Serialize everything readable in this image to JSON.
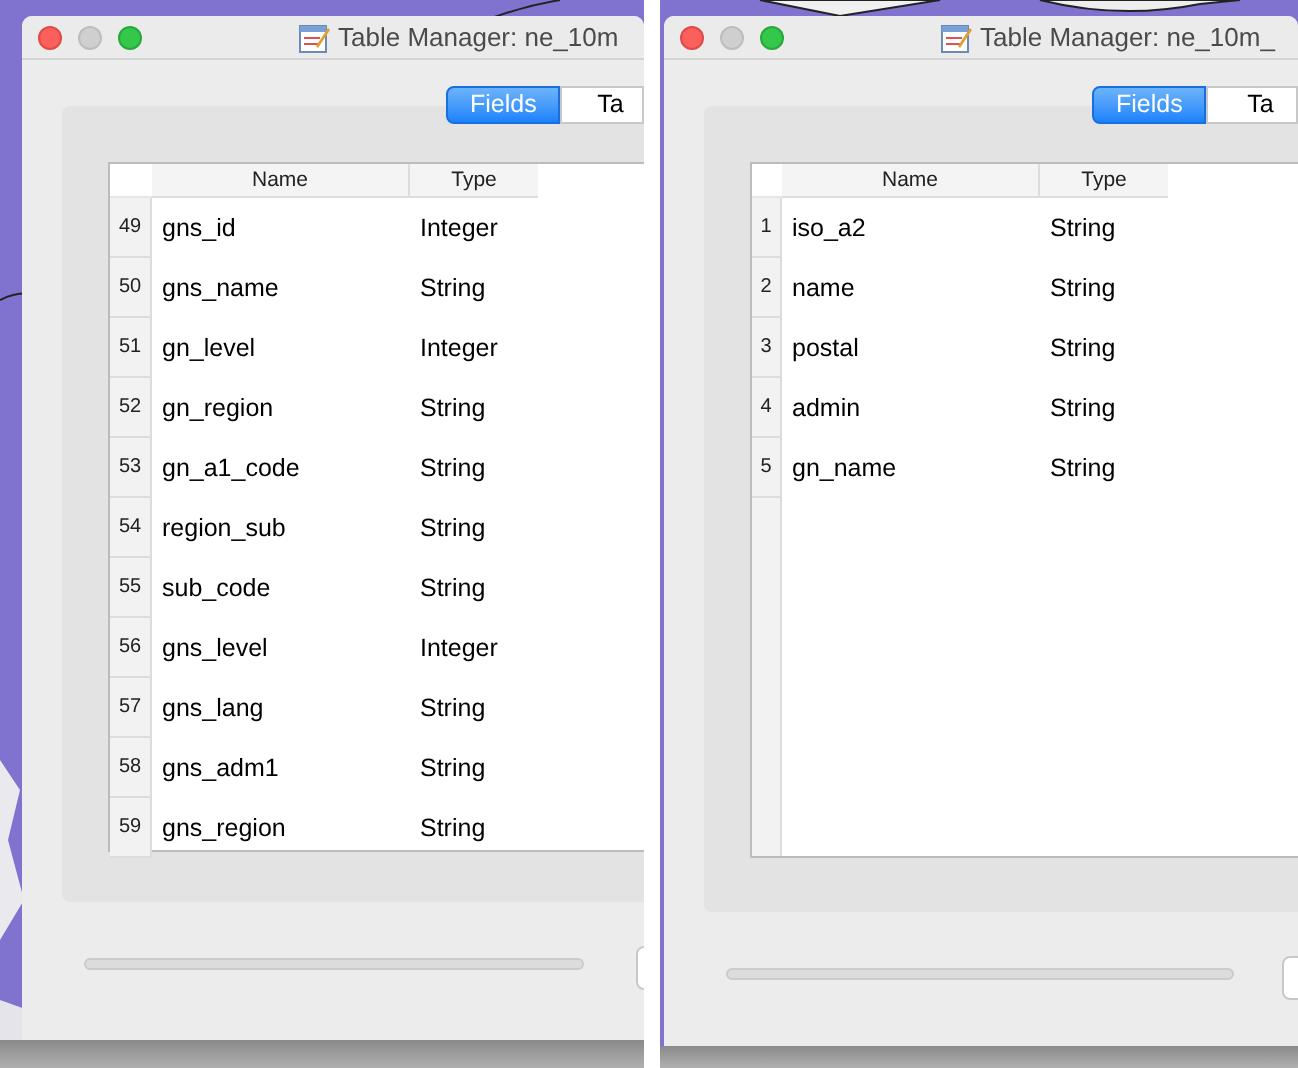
{
  "windows": [
    {
      "title": "Table Manager: ne_10m",
      "tabs": [
        {
          "label": "Fields",
          "selected": true
        },
        {
          "label": "Ta",
          "selected": false
        }
      ],
      "table": {
        "columns": [
          "Name",
          "Type"
        ],
        "rows": [
          {
            "number": "49",
            "name": "gns_id",
            "type": "Integer"
          },
          {
            "number": "50",
            "name": "gns_name",
            "type": "String"
          },
          {
            "number": "51",
            "name": "gn_level",
            "type": "Integer"
          },
          {
            "number": "52",
            "name": "gn_region",
            "type": "String"
          },
          {
            "number": "53",
            "name": "gn_a1_code",
            "type": "String"
          },
          {
            "number": "54",
            "name": "region_sub",
            "type": "String"
          },
          {
            "number": "55",
            "name": "sub_code",
            "type": "String"
          },
          {
            "number": "56",
            "name": "gns_level",
            "type": "Integer"
          },
          {
            "number": "57",
            "name": "gns_lang",
            "type": "String"
          },
          {
            "number": "58",
            "name": "gns_adm1",
            "type": "String"
          },
          {
            "number": "59",
            "name": "gns_region",
            "type": "String"
          }
        ]
      },
      "progress": {
        "level": 0
      }
    },
    {
      "title": "Table Manager: ne_10m_",
      "tabs": [
        {
          "label": "Fields",
          "selected": true
        },
        {
          "label": "Ta",
          "selected": false
        }
      ],
      "table": {
        "columns": [
          "Name",
          "Type"
        ],
        "rows": [
          {
            "number": "1",
            "name": "iso_a2",
            "type": "String"
          },
          {
            "number": "2",
            "name": "name",
            "type": "String"
          },
          {
            "number": "3",
            "name": "postal",
            "type": "String"
          },
          {
            "number": "4",
            "name": "admin",
            "type": "String"
          },
          {
            "number": "5",
            "name": "gn_name",
            "type": "String"
          }
        ]
      },
      "progress": {
        "level": 0
      }
    }
  ]
}
